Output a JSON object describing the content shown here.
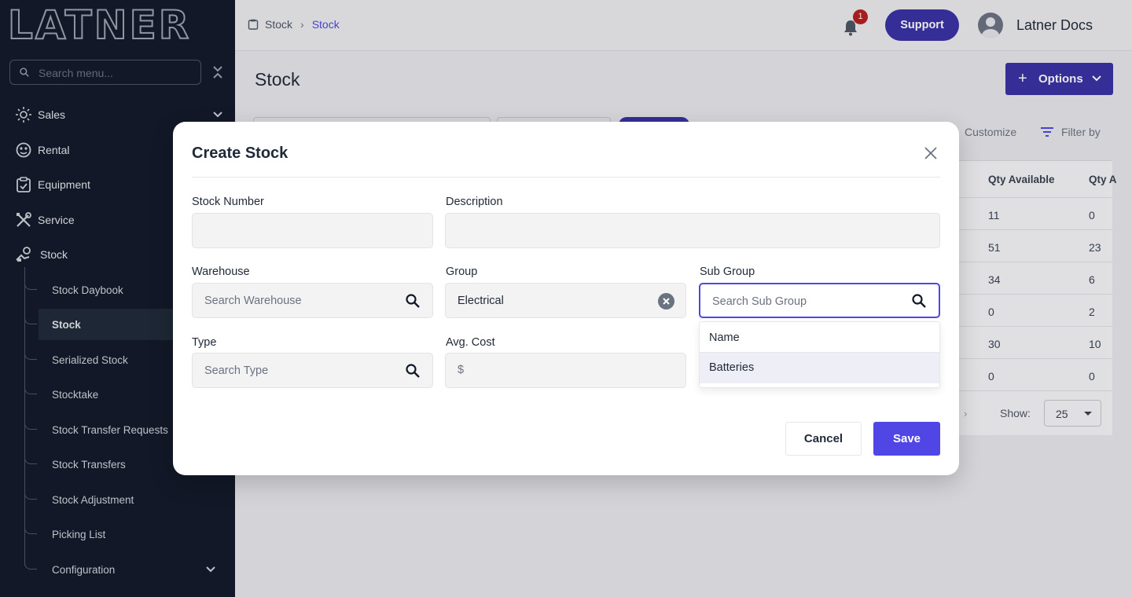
{
  "sidebar": {
    "logo": "LATNER",
    "search_placeholder": "Search menu...",
    "items": [
      {
        "label": "Sales",
        "icon": "sales-icon"
      },
      {
        "label": "Rental",
        "icon": "rental-icon"
      },
      {
        "label": "Equipment",
        "icon": "equipment-icon"
      },
      {
        "label": "Service",
        "icon": "service-icon"
      },
      {
        "label": "Stock",
        "icon": "stock-icon"
      }
    ],
    "stock_sub": [
      {
        "label": "Stock Daybook"
      },
      {
        "label": "Stock"
      },
      {
        "label": "Serialized Stock"
      },
      {
        "label": "Stocktake"
      },
      {
        "label": "Stock Transfer Requests"
      },
      {
        "label": "Stock Transfers"
      },
      {
        "label": "Stock Adjustment"
      },
      {
        "label": "Picking List"
      },
      {
        "label": "Configuration"
      }
    ]
  },
  "header": {
    "breadcrumb": [
      "Stock",
      "Stock"
    ],
    "notification_count": "1",
    "support_label": "Support",
    "user_name": "Latner Docs"
  },
  "page": {
    "title": "Stock",
    "options_label": "Options",
    "customize_label": "Customize",
    "filter_label": "Filter by",
    "columns": [
      "Qty Available",
      "Qty A"
    ],
    "rows": [
      [
        "11",
        "0"
      ],
      [
        "51",
        "23"
      ],
      [
        "34",
        "6"
      ],
      [
        "0",
        "2"
      ],
      [
        "30",
        "10"
      ],
      [
        "0",
        "0"
      ]
    ],
    "show_label": "Show:",
    "show_value": "25"
  },
  "modal": {
    "title": "Create Stock",
    "fields": {
      "stock_number": {
        "label": "Stock Number",
        "value": ""
      },
      "description": {
        "label": "Description",
        "value": ""
      },
      "warehouse": {
        "label": "Warehouse",
        "placeholder": "Search Warehouse"
      },
      "group": {
        "label": "Group",
        "value": "Electrical"
      },
      "sub_group": {
        "label": "Sub Group",
        "placeholder": "Search Sub Group"
      },
      "type": {
        "label": "Type",
        "placeholder": "Search Type"
      },
      "avg_cost": {
        "label": "Avg. Cost",
        "prefix": "$"
      }
    },
    "dropdown": {
      "header": "Name",
      "options": [
        "Batteries"
      ]
    },
    "cancel_label": "Cancel",
    "save_label": "Save"
  },
  "colors": {
    "accent": "#4f46e5",
    "brand_dark": "#3730a3",
    "sidebar_bg": "#111827",
    "badge": "#b91c1c"
  }
}
